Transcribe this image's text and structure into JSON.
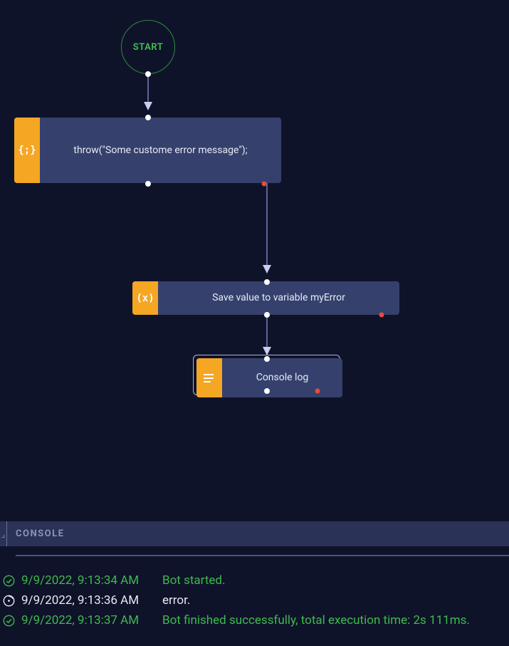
{
  "flow": {
    "start_label": "START",
    "nodes": {
      "throw": {
        "handle_text": "{;}",
        "label": "throw(\"Some custome error message\");"
      },
      "save": {
        "handle_text": "(x)",
        "label": "Save value to variable myError"
      },
      "log": {
        "handle_text": "≡",
        "label": "Console log"
      }
    }
  },
  "console": {
    "title": "CONSOLE",
    "rows": [
      {
        "type": "success",
        "ts": "9/9/2022, 9:13:34 AM",
        "msg": "Bot started."
      },
      {
        "type": "error",
        "ts": "9/9/2022, 9:13:36 AM",
        "msg": "error."
      },
      {
        "type": "success",
        "ts": "9/9/2022, 9:13:37 AM",
        "msg": "Bot finished successfully, total execution time: 2s 111ms."
      }
    ]
  }
}
